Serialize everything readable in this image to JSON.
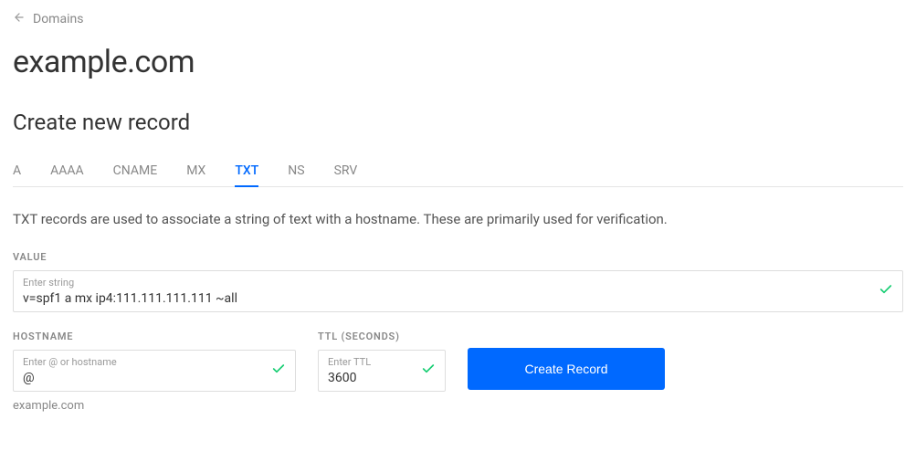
{
  "breadcrumb": {
    "label": "Domains"
  },
  "domain_title": "example.com",
  "subtitle": "Create new record",
  "tabs": {
    "a": "A",
    "aaaa": "AAAA",
    "cname": "CNAME",
    "mx": "MX",
    "txt": "TXT",
    "ns": "NS",
    "srv": "SRV"
  },
  "description": "TXT records are used to associate a string of text with a hostname. These are primarily used for verification.",
  "fields": {
    "value": {
      "label": "VALUE",
      "placeholder": "Enter string",
      "value": "v=spf1 a mx ip4:111.111.111.111 ~all"
    },
    "hostname": {
      "label": "HOSTNAME",
      "placeholder": "Enter @ or hostname",
      "value": "@",
      "helper": "example.com"
    },
    "ttl": {
      "label": "TTL (SECONDS)",
      "placeholder": "Enter TTL",
      "value": "3600"
    }
  },
  "create_button": "Create Record"
}
